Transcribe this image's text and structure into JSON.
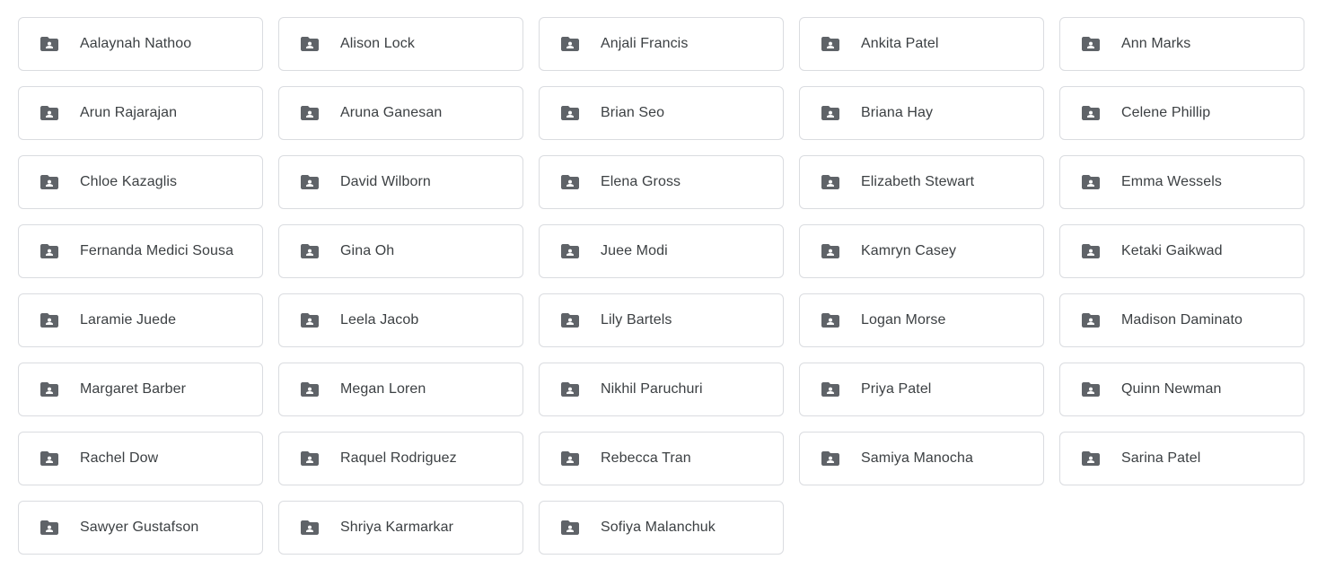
{
  "icon": "shared-folder-icon",
  "colors": {
    "border": "#dadce0",
    "icon": "#5f6368",
    "text": "#3c4043"
  },
  "folders": [
    {
      "name": "Aalaynah Nathoo"
    },
    {
      "name": "Alison Lock"
    },
    {
      "name": "Anjali Francis"
    },
    {
      "name": "Ankita Patel"
    },
    {
      "name": "Ann Marks"
    },
    {
      "name": "Arun Rajarajan"
    },
    {
      "name": "Aruna Ganesan"
    },
    {
      "name": "Brian Seo"
    },
    {
      "name": "Briana Hay"
    },
    {
      "name": "Celene Phillip"
    },
    {
      "name": "Chloe Kazaglis"
    },
    {
      "name": "David Wilborn"
    },
    {
      "name": "Elena Gross"
    },
    {
      "name": "Elizabeth Stewart"
    },
    {
      "name": "Emma Wessels"
    },
    {
      "name": "Fernanda Medici Sousa"
    },
    {
      "name": "Gina Oh"
    },
    {
      "name": "Juee Modi"
    },
    {
      "name": "Kamryn Casey"
    },
    {
      "name": "Ketaki Gaikwad"
    },
    {
      "name": "Laramie Juede"
    },
    {
      "name": "Leela Jacob"
    },
    {
      "name": "Lily Bartels"
    },
    {
      "name": "Logan Morse"
    },
    {
      "name": "Madison Daminato"
    },
    {
      "name": "Margaret Barber"
    },
    {
      "name": "Megan Loren"
    },
    {
      "name": "Nikhil Paruchuri"
    },
    {
      "name": "Priya Patel"
    },
    {
      "name": "Quinn Newman"
    },
    {
      "name": "Rachel Dow"
    },
    {
      "name": "Raquel Rodriguez"
    },
    {
      "name": "Rebecca Tran"
    },
    {
      "name": "Samiya Manocha"
    },
    {
      "name": "Sarina Patel"
    },
    {
      "name": "Sawyer Gustafson"
    },
    {
      "name": "Shriya Karmarkar"
    },
    {
      "name": "Sofiya Malanchuk"
    }
  ]
}
